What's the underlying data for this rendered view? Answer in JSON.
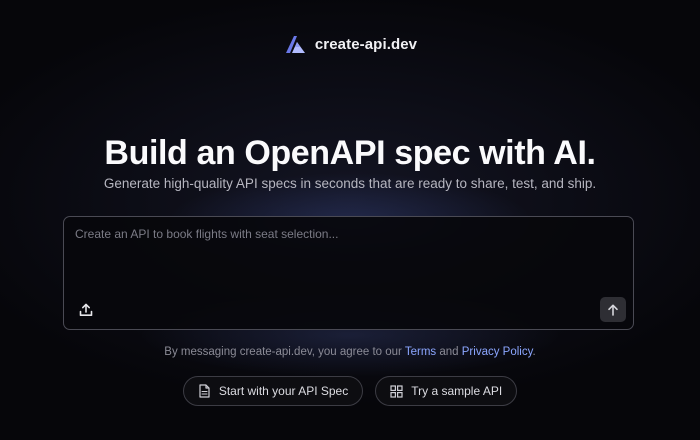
{
  "brand": {
    "name": "create-api.dev",
    "icon": "create-api-logo-icon",
    "colors": [
      "#9aa8ff",
      "#6a78e8"
    ]
  },
  "hero": {
    "title": "Build an OpenAPI spec with AI.",
    "subtitle": "Generate high-quality API specs in seconds that are ready to share, test, and ship."
  },
  "prompt": {
    "value": "",
    "placeholder": "Create an API to book flights with seat selection...",
    "upload_icon": "upload-icon",
    "send_icon": "arrow-up-icon"
  },
  "legal": {
    "prefix": "By messaging create-api.dev, you agree to our ",
    "terms_label": "Terms",
    "conjunction": " and ",
    "privacy_label": "Privacy Policy",
    "suffix": ".",
    "link_color": "#8ba6ff"
  },
  "actions": {
    "start_spec_label": "Start with your API Spec",
    "start_spec_icon": "document-icon",
    "sample_label": "Try a sample API",
    "sample_icon": "grid-icon"
  }
}
